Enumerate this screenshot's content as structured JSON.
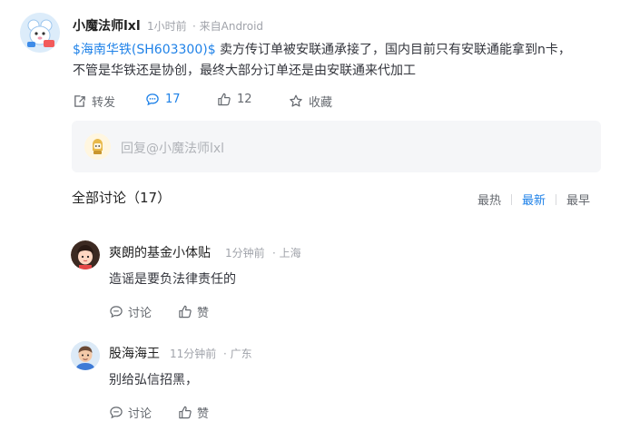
{
  "post": {
    "author": "小魔法师lxl",
    "time": "1小时前",
    "source": "· 来自Android",
    "stock_link": "$海南华铁(SH603300)$",
    "text_line1": " 卖方传订单被安联通承接了，国内目前只有安联通能拿到n卡，",
    "text_line2": "不管是华铁还是协创，最终大部分订单还是由安联通来代加工",
    "actions": {
      "repost": "转发",
      "comment_count": "17",
      "like_count": "12",
      "favorite": "收藏"
    }
  },
  "reply": {
    "placeholder": "回复@小魔法师lxl"
  },
  "discussion": {
    "title": "全部讨论（17）",
    "sort": [
      "最热",
      "最新",
      "最早"
    ],
    "active_sort": "最新"
  },
  "comments": [
    {
      "name": "爽朗的基金小体贴",
      "time": "1分钟前",
      "location": "· 上海",
      "text": "造谣是要负法律责任的",
      "comment_label": "讨论",
      "like_label": "赞"
    },
    {
      "name": "股海海王",
      "time": "11分钟前",
      "location": "· 广东",
      "text": "别给弘信招黑，",
      "comment_label": "讨论",
      "like_label": "赞"
    }
  ],
  "colors": {
    "accent": "#1f82e8",
    "muted": "#a0a3aa",
    "reply_bg": "#f5f6f8"
  },
  "icons": {
    "repost": "share-icon",
    "comment": "comment-icon",
    "like": "thumb-up-icon",
    "favorite": "star-icon"
  }
}
